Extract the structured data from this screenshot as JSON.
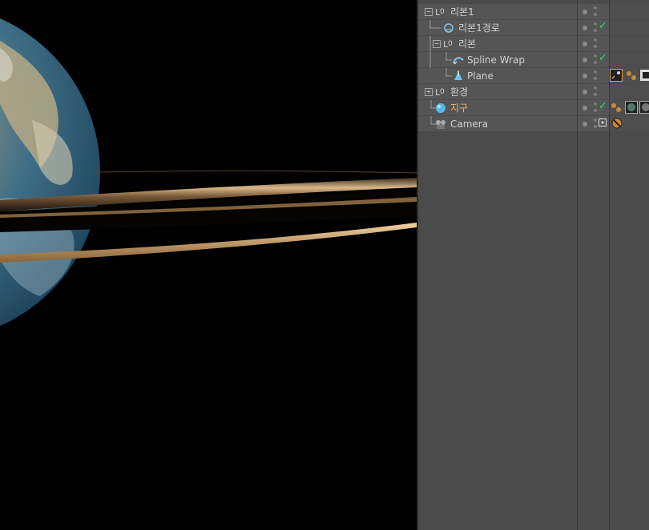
{
  "objects": [
    {
      "name": "리본1",
      "type": "null",
      "color": "#d0d0d0"
    },
    {
      "name": "리본1경로",
      "type": "spline",
      "color": "#d0d0d0"
    },
    {
      "name": "리본",
      "type": "null",
      "color": "#d0d0d0"
    },
    {
      "name": "Spline Wrap",
      "type": "deformer",
      "color": "#d0d0d0"
    },
    {
      "name": "Plane",
      "type": "plane",
      "color": "#d0d0d0"
    },
    {
      "name": "환경",
      "type": "null",
      "color": "#d0d0d0"
    },
    {
      "name": "지구",
      "type": "sphere",
      "color": "#f0b45a"
    },
    {
      "name": "Camera",
      "type": "camera",
      "color": "#d0d0d0"
    }
  ],
  "colors": {
    "panel_bg": "#4b4b4b",
    "row_bg": "#555555",
    "check_green": "#4ed16a",
    "selected_label": "#f0b45a"
  }
}
